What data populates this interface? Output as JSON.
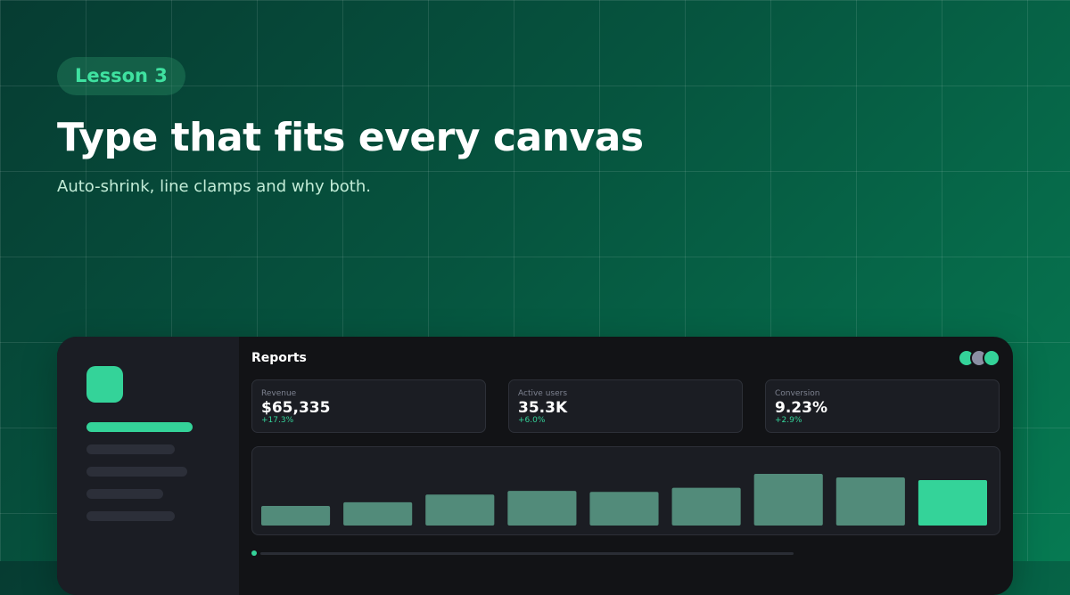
{
  "hero": {
    "badge": "Lesson 3",
    "headline": "Type that fits every canvas",
    "subtitle": "Auto-shrink, line clamps and why both."
  },
  "dashboard": {
    "title": "Reports",
    "avatars": [
      {
        "color": "#34d399"
      },
      {
        "color": "#8b8fa3"
      },
      {
        "color": "#34d399"
      }
    ],
    "stats": [
      {
        "label": "Revenue",
        "value": "$65,335",
        "delta": "+17.3%"
      },
      {
        "label": "Active users",
        "value": "35.3K",
        "delta": "+6.0%"
      },
      {
        "label": "Conversion",
        "value": "9.23%",
        "delta": "+2.9%"
      }
    ],
    "sidebar": {
      "items": [
        {
          "active": true
        },
        {
          "active": false
        },
        {
          "active": false
        },
        {
          "active": false
        },
        {
          "active": false
        }
      ]
    }
  },
  "chart_data": {
    "type": "bar",
    "values": [
      0.38,
      0.45,
      0.6,
      0.67,
      0.65,
      0.73,
      1.0,
      0.93,
      0.88
    ],
    "highlight_index": 8,
    "colors": {
      "bar": "#528b7a",
      "highlight": "#34d399"
    }
  },
  "colors": {
    "accent": "#34d399",
    "background_start": "#063c32",
    "background_end": "#067a52",
    "panel": "#121316",
    "sidebar": "#1b1d24"
  }
}
